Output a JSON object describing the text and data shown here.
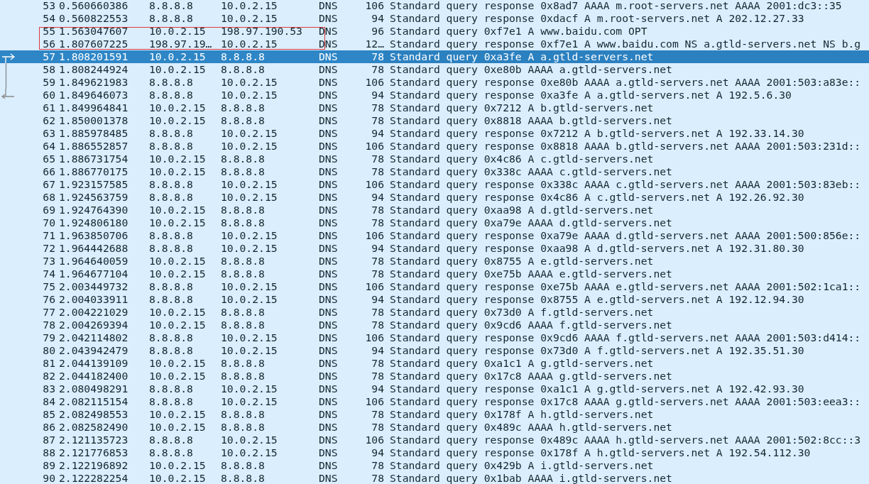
{
  "packets": [
    {
      "no": "53",
      "time": "0.560660386",
      "source": "8.8.8.8",
      "destination": "10.0.2.15",
      "protocol": "DNS",
      "length": "106",
      "info": "Standard query response 0x8ad7 AAAA m.root-servers.net AAAA 2001:dc3::35",
      "selected": false
    },
    {
      "no": "54",
      "time": "0.560822553",
      "source": "8.8.8.8",
      "destination": "10.0.2.15",
      "protocol": "DNS",
      "length": "94",
      "info": "Standard query response 0xdacf A m.root-servers.net A 202.12.27.33",
      "selected": false
    },
    {
      "no": "55",
      "time": "1.563047607",
      "source": "10.0.2.15",
      "destination": "198.97.190.53",
      "protocol": "DNS",
      "length": "96",
      "info": "Standard query 0xf7e1 A www.baidu.com OPT",
      "selected": false,
      "boxed": true
    },
    {
      "no": "56",
      "time": "1.807607225",
      "source": "198.97.19…",
      "destination": "10.0.2.15",
      "protocol": "DNS",
      "length": "12…",
      "info": "Standard query response 0xf7e1 A www.baidu.com NS a.gtld-servers.net NS b.g",
      "selected": false,
      "boxed": true
    },
    {
      "no": "57",
      "time": "1.808201591",
      "source": "10.0.2.15",
      "destination": "8.8.8.8",
      "protocol": "DNS",
      "length": "78",
      "info": "Standard query 0xa3fe A a.gtld-servers.net",
      "selected": true,
      "kind": "request"
    },
    {
      "no": "58",
      "time": "1.808244924",
      "source": "10.0.2.15",
      "destination": "8.8.8.8",
      "protocol": "DNS",
      "length": "78",
      "info": "Standard query 0xe80b AAAA a.gtld-servers.net",
      "selected": false,
      "kind": "between"
    },
    {
      "no": "59",
      "time": "1.849621983",
      "source": "8.8.8.8",
      "destination": "10.0.2.15",
      "protocol": "DNS",
      "length": "106",
      "info": "Standard query response 0xe80b AAAA a.gtld-servers.net AAAA 2001:503:a83e::",
      "selected": false,
      "kind": "between"
    },
    {
      "no": "60",
      "time": "1.849646073",
      "source": "8.8.8.8",
      "destination": "10.0.2.15",
      "protocol": "DNS",
      "length": "94",
      "info": "Standard query response 0xa3fe A a.gtld-servers.net A 192.5.6.30",
      "selected": false,
      "kind": "response"
    },
    {
      "no": "61",
      "time": "1.849964841",
      "source": "10.0.2.15",
      "destination": "8.8.8.8",
      "protocol": "DNS",
      "length": "78",
      "info": "Standard query 0x7212 A b.gtld-servers.net",
      "selected": false
    },
    {
      "no": "62",
      "time": "1.850001378",
      "source": "10.0.2.15",
      "destination": "8.8.8.8",
      "protocol": "DNS",
      "length": "78",
      "info": "Standard query 0x8818 AAAA b.gtld-servers.net",
      "selected": false
    },
    {
      "no": "63",
      "time": "1.885978485",
      "source": "8.8.8.8",
      "destination": "10.0.2.15",
      "protocol": "DNS",
      "length": "94",
      "info": "Standard query response 0x7212 A b.gtld-servers.net A 192.33.14.30",
      "selected": false
    },
    {
      "no": "64",
      "time": "1.886552857",
      "source": "8.8.8.8",
      "destination": "10.0.2.15",
      "protocol": "DNS",
      "length": "106",
      "info": "Standard query response 0x8818 AAAA b.gtld-servers.net AAAA 2001:503:231d::",
      "selected": false
    },
    {
      "no": "65",
      "time": "1.886731754",
      "source": "10.0.2.15",
      "destination": "8.8.8.8",
      "protocol": "DNS",
      "length": "78",
      "info": "Standard query 0x4c86 A c.gtld-servers.net",
      "selected": false
    },
    {
      "no": "66",
      "time": "1.886770175",
      "source": "10.0.2.15",
      "destination": "8.8.8.8",
      "protocol": "DNS",
      "length": "78",
      "info": "Standard query 0x338c AAAA c.gtld-servers.net",
      "selected": false
    },
    {
      "no": "67",
      "time": "1.923157585",
      "source": "8.8.8.8",
      "destination": "10.0.2.15",
      "protocol": "DNS",
      "length": "106",
      "info": "Standard query response 0x338c AAAA c.gtld-servers.net AAAA 2001:503:83eb::",
      "selected": false
    },
    {
      "no": "68",
      "time": "1.924563759",
      "source": "8.8.8.8",
      "destination": "10.0.2.15",
      "protocol": "DNS",
      "length": "94",
      "info": "Standard query response 0x4c86 A c.gtld-servers.net A 192.26.92.30",
      "selected": false
    },
    {
      "no": "69",
      "time": "1.924764390",
      "source": "10.0.2.15",
      "destination": "8.8.8.8",
      "protocol": "DNS",
      "length": "78",
      "info": "Standard query 0xaa98 A d.gtld-servers.net",
      "selected": false
    },
    {
      "no": "70",
      "time": "1.924806180",
      "source": "10.0.2.15",
      "destination": "8.8.8.8",
      "protocol": "DNS",
      "length": "78",
      "info": "Standard query 0xa79e AAAA d.gtld-servers.net",
      "selected": false
    },
    {
      "no": "71",
      "time": "1.963850706",
      "source": "8.8.8.8",
      "destination": "10.0.2.15",
      "protocol": "DNS",
      "length": "106",
      "info": "Standard query response 0xa79e AAAA d.gtld-servers.net AAAA 2001:500:856e::",
      "selected": false
    },
    {
      "no": "72",
      "time": "1.964442688",
      "source": "8.8.8.8",
      "destination": "10.0.2.15",
      "protocol": "DNS",
      "length": "94",
      "info": "Standard query response 0xaa98 A d.gtld-servers.net A 192.31.80.30",
      "selected": false
    },
    {
      "no": "73",
      "time": "1.964640059",
      "source": "10.0.2.15",
      "destination": "8.8.8.8",
      "protocol": "DNS",
      "length": "78",
      "info": "Standard query 0x8755 A e.gtld-servers.net",
      "selected": false
    },
    {
      "no": "74",
      "time": "1.964677104",
      "source": "10.0.2.15",
      "destination": "8.8.8.8",
      "protocol": "DNS",
      "length": "78",
      "info": "Standard query 0xe75b AAAA e.gtld-servers.net",
      "selected": false
    },
    {
      "no": "75",
      "time": "2.003449732",
      "source": "8.8.8.8",
      "destination": "10.0.2.15",
      "protocol": "DNS",
      "length": "106",
      "info": "Standard query response 0xe75b AAAA e.gtld-servers.net AAAA 2001:502:1ca1::",
      "selected": false
    },
    {
      "no": "76",
      "time": "2.004033911",
      "source": "8.8.8.8",
      "destination": "10.0.2.15",
      "protocol": "DNS",
      "length": "94",
      "info": "Standard query response 0x8755 A e.gtld-servers.net A 192.12.94.30",
      "selected": false
    },
    {
      "no": "77",
      "time": "2.004221029",
      "source": "10.0.2.15",
      "destination": "8.8.8.8",
      "protocol": "DNS",
      "length": "78",
      "info": "Standard query 0x73d0 A f.gtld-servers.net",
      "selected": false
    },
    {
      "no": "78",
      "time": "2.004269394",
      "source": "10.0.2.15",
      "destination": "8.8.8.8",
      "protocol": "DNS",
      "length": "78",
      "info": "Standard query 0x9cd6 AAAA f.gtld-servers.net",
      "selected": false
    },
    {
      "no": "79",
      "time": "2.042114802",
      "source": "8.8.8.8",
      "destination": "10.0.2.15",
      "protocol": "DNS",
      "length": "106",
      "info": "Standard query response 0x9cd6 AAAA f.gtld-servers.net AAAA 2001:503:d414::",
      "selected": false
    },
    {
      "no": "80",
      "time": "2.043942479",
      "source": "8.8.8.8",
      "destination": "10.0.2.15",
      "protocol": "DNS",
      "length": "94",
      "info": "Standard query response 0x73d0 A f.gtld-servers.net A 192.35.51.30",
      "selected": false
    },
    {
      "no": "81",
      "time": "2.044139109",
      "source": "10.0.2.15",
      "destination": "8.8.8.8",
      "protocol": "DNS",
      "length": "78",
      "info": "Standard query 0xa1c1 A g.gtld-servers.net",
      "selected": false
    },
    {
      "no": "82",
      "time": "2.044182400",
      "source": "10.0.2.15",
      "destination": "8.8.8.8",
      "protocol": "DNS",
      "length": "78",
      "info": "Standard query 0x17c8 AAAA g.gtld-servers.net",
      "selected": false
    },
    {
      "no": "83",
      "time": "2.080498291",
      "source": "8.8.8.8",
      "destination": "10.0.2.15",
      "protocol": "DNS",
      "length": "94",
      "info": "Standard query response 0xa1c1 A g.gtld-servers.net A 192.42.93.30",
      "selected": false
    },
    {
      "no": "84",
      "time": "2.082115154",
      "source": "8.8.8.8",
      "destination": "10.0.2.15",
      "protocol": "DNS",
      "length": "106",
      "info": "Standard query response 0x17c8 AAAA g.gtld-servers.net AAAA 2001:503:eea3::",
      "selected": false
    },
    {
      "no": "85",
      "time": "2.082498553",
      "source": "10.0.2.15",
      "destination": "8.8.8.8",
      "protocol": "DNS",
      "length": "78",
      "info": "Standard query 0x178f A h.gtld-servers.net",
      "selected": false
    },
    {
      "no": "86",
      "time": "2.082582490",
      "source": "10.0.2.15",
      "destination": "8.8.8.8",
      "protocol": "DNS",
      "length": "78",
      "info": "Standard query 0x489c AAAA h.gtld-servers.net",
      "selected": false
    },
    {
      "no": "87",
      "time": "2.121135723",
      "source": "8.8.8.8",
      "destination": "10.0.2.15",
      "protocol": "DNS",
      "length": "106",
      "info": "Standard query response 0x489c AAAA h.gtld-servers.net AAAA 2001:502:8cc::3",
      "selected": false
    },
    {
      "no": "88",
      "time": "2.121776853",
      "source": "8.8.8.8",
      "destination": "10.0.2.15",
      "protocol": "DNS",
      "length": "94",
      "info": "Standard query response 0x178f A h.gtld-servers.net A 192.54.112.30",
      "selected": false
    },
    {
      "no": "89",
      "time": "2.122196892",
      "source": "10.0.2.15",
      "destination": "8.8.8.8",
      "protocol": "DNS",
      "length": "78",
      "info": "Standard query 0x429b A i.gtld-servers.net",
      "selected": false
    },
    {
      "no": "90",
      "time": "2.122282254",
      "source": "10.0.2.15",
      "destination": "8.8.8.8",
      "protocol": "DNS",
      "length": "78",
      "info": "Standard query 0x1bab AAAA i.gtld-servers.net",
      "selected": false
    }
  ]
}
